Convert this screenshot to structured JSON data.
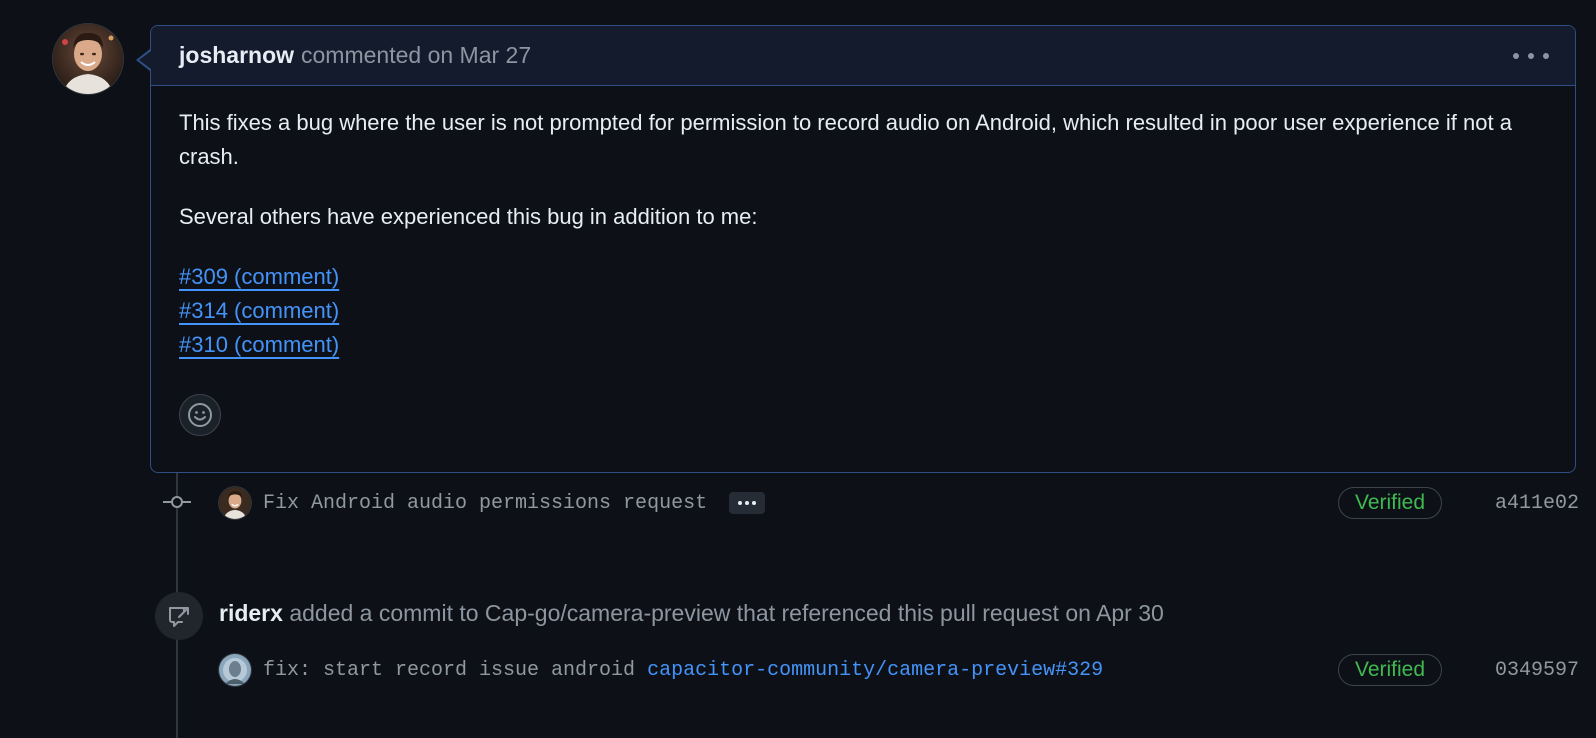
{
  "comment": {
    "author": "josharnow",
    "meta": "commented on Mar 27",
    "body_p1": "This fixes a bug where the user is not prompted for permission to record audio on Android, which resulted in poor user experience if not a crash.",
    "body_p2": "Several others have experienced this bug in addition to me:",
    "links": [
      "#309 (comment)",
      "#314 (comment)",
      "#310 (comment)"
    ]
  },
  "commit1": {
    "message": "Fix Android audio permissions request",
    "verified_label": "Verified",
    "sha": "a411e02"
  },
  "event": {
    "actor": "riderx",
    "text": "added a commit to Cap-go/camera-preview that referenced this pull request on Apr 30"
  },
  "commit2": {
    "message": "fix: start record issue android",
    "ref_link": "capacitor-community/camera-preview#329",
    "verified_label": "Verified",
    "sha": "0349597"
  },
  "colors": {
    "background": "#0d1117",
    "header_bg": "#141b2d",
    "border_accent": "#2f4f82",
    "link": "#4493f8",
    "verified": "#3fb950",
    "muted": "#8d96a0"
  }
}
